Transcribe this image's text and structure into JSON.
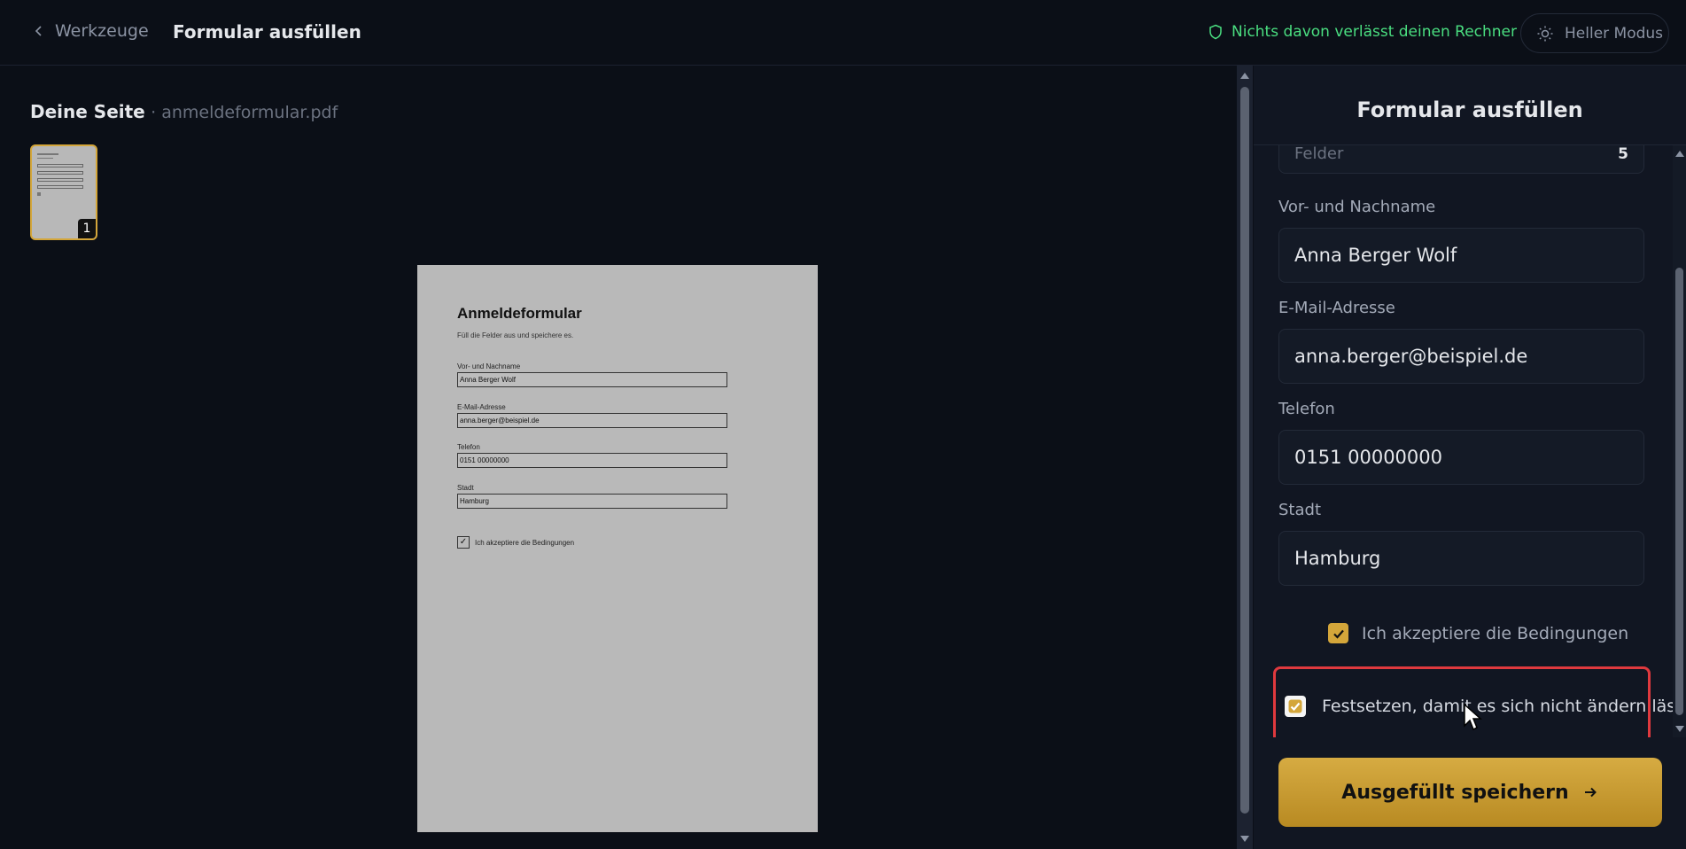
{
  "header": {
    "back_label": "Werkzeuge",
    "title": "Formular ausfüllen",
    "privacy_note": "Nichts davon verlässt deinen Rechner",
    "theme_toggle_label": "Heller Modus"
  },
  "preview": {
    "heading": "Deine Seite",
    "filename_suffix": "· anmeldeformular.pdf",
    "thumbnail_page_number": "1",
    "document": {
      "title": "Anmeldeformular",
      "subtitle": "Füll die Felder aus und speichere es.",
      "fields": [
        {
          "label": "Vor- und Nachname",
          "value": "Anna Berger Wolf"
        },
        {
          "label": "E-Mail-Adresse",
          "value": "anna.berger@beispiel.de"
        },
        {
          "label": "Telefon",
          "value": "0151 00000000"
        },
        {
          "label": "Stadt",
          "value": "Hamburg"
        }
      ],
      "checkbox_mark": "✓",
      "checkbox_label": "Ich akzeptiere die Bedingungen"
    }
  },
  "panel": {
    "title": "Formular ausfüllen",
    "count_label": "Felder",
    "count_value": "5",
    "fields": [
      {
        "label": "Vor- und Nachname",
        "value": "Anna Berger Wolf"
      },
      {
        "label": "E-Mail-Adresse",
        "value": "anna.berger@beispiel.de"
      },
      {
        "label": "Telefon",
        "value": "0151 00000000"
      },
      {
        "label": "Stadt",
        "value": "Hamburg"
      }
    ],
    "accept_label": "Ich akzeptiere die Bedingungen",
    "accept_checked": true,
    "lock_label": "Festsetzen, damit es sich nicht ändern lässt",
    "lock_checked": true,
    "save_label": "Ausgefüllt speichern"
  },
  "colors": {
    "accent": "#d4a63a",
    "privacy": "#4ade80",
    "highlight_border": "#e0393e",
    "background": "#0b0f17"
  }
}
